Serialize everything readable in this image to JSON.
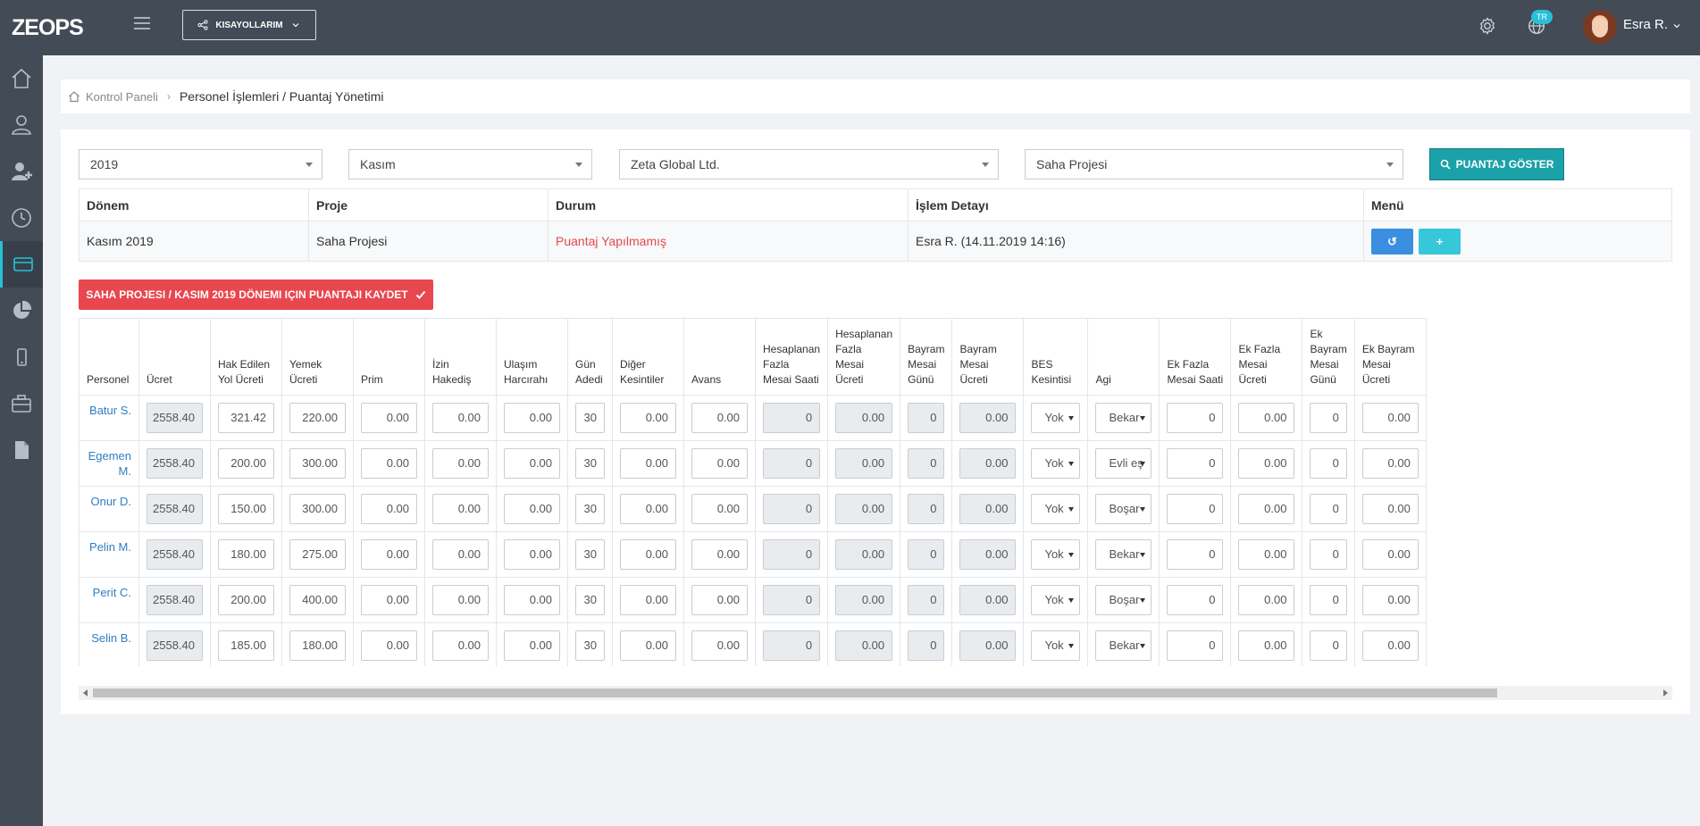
{
  "app": {
    "logo": "ZEOPS",
    "shortcuts_label": "KISAYOLLARIM",
    "lang_badge": "TR",
    "user_name": "Esra R."
  },
  "sidebar": {
    "items": [
      {
        "icon": "home-icon"
      },
      {
        "icon": "users-icon"
      },
      {
        "icon": "user-add-icon"
      },
      {
        "icon": "clock-icon"
      },
      {
        "icon": "credit-card-icon",
        "active": true
      },
      {
        "icon": "pie-chart-icon"
      },
      {
        "icon": "mobile-icon"
      },
      {
        "icon": "briefcase-icon"
      },
      {
        "icon": "document-icon"
      }
    ]
  },
  "breadcrumb": {
    "home": "Kontrol Paneli",
    "current": "Personel İşlemleri / Puantaj Yönetimi"
  },
  "filters": {
    "year": "2019",
    "month": "Kasım",
    "company": "Zeta Global Ltd.",
    "project": "Saha Projesi",
    "show_button": "PUANTAJ GÖSTER"
  },
  "summary": {
    "headers": [
      "Dönem",
      "Proje",
      "Durum",
      "İşlem Detayı",
      "Menü"
    ],
    "row": {
      "period": "Kasım 2019",
      "project": "Saha Projesi",
      "status": "Puantaj Yapılmamış",
      "detail": "Esra R. (14.11.2019 14:16)"
    }
  },
  "save_button": "SAHA PROJESI / KASIM 2019 DÖNEMI IÇIN PUANTAJI KAYDET",
  "grid": {
    "headers": [
      "Personel",
      "Ücret",
      "Hak Edilen Yol Ücreti",
      "Yemek Ücreti",
      "Prim",
      "İzin Hakediş",
      "Ulaşım Harcırahı",
      "Gün Adedi",
      "Diğer Kesintiler",
      "Avans",
      "Hesaplanan Fazla Mesai Saati",
      "Hesaplanan Fazla Mesai Ücreti",
      "Bayram Mesai Günü",
      "Bayram Mesai Ücreti",
      "BES Kesintisi",
      "Agi",
      "Ek Fazla Mesai Saati",
      "Ek Fazla Mesai Ücreti",
      "Ek Bayram Mesai Günü",
      "Ek Bayram Mesai Ücreti"
    ],
    "rows": [
      {
        "name": "Batur S.",
        "ucret": "2558.40",
        "yol": "321.42",
        "yemek": "220.00",
        "prim": "0.00",
        "izin": "0.00",
        "ulasim": "0.00",
        "gun": "30",
        "diger": "0.00",
        "avans": "0.00",
        "hfms": "0",
        "hfmu": "0.00",
        "bmg": "0",
        "bmu": "0.00",
        "bes": "Yok",
        "agi": "Bekar",
        "efms": "0",
        "efmu": "0.00",
        "ebmg": "0",
        "ebmu": "0.00"
      },
      {
        "name": "Egemen M.",
        "ucret": "2558.40",
        "yol": "200.00",
        "yemek": "300.00",
        "prim": "0.00",
        "izin": "0.00",
        "ulasim": "0.00",
        "gun": "30",
        "diger": "0.00",
        "avans": "0.00",
        "hfms": "0",
        "hfmu": "0.00",
        "bmg": "0",
        "bmu": "0.00",
        "bes": "Yok",
        "agi": "Evli eş",
        "efms": "0",
        "efmu": "0.00",
        "ebmg": "0",
        "ebmu": "0.00"
      },
      {
        "name": "Onur D.",
        "ucret": "2558.40",
        "yol": "150.00",
        "yemek": "300.00",
        "prim": "0.00",
        "izin": "0.00",
        "ulasim": "0.00",
        "gun": "30",
        "diger": "0.00",
        "avans": "0.00",
        "hfms": "0",
        "hfmu": "0.00",
        "bmg": "0",
        "bmu": "0.00",
        "bes": "Yok",
        "agi": "Boşar",
        "efms": "0",
        "efmu": "0.00",
        "ebmg": "0",
        "ebmu": "0.00"
      },
      {
        "name": "Pelin M.",
        "ucret": "2558.40",
        "yol": "180.00",
        "yemek": "275.00",
        "prim": "0.00",
        "izin": "0.00",
        "ulasim": "0.00",
        "gun": "30",
        "diger": "0.00",
        "avans": "0.00",
        "hfms": "0",
        "hfmu": "0.00",
        "bmg": "0",
        "bmu": "0.00",
        "bes": "Yok",
        "agi": "Bekar",
        "efms": "0",
        "efmu": "0.00",
        "ebmg": "0",
        "ebmu": "0.00"
      },
      {
        "name": "Perit C.",
        "ucret": "2558.40",
        "yol": "200.00",
        "yemek": "400.00",
        "prim": "0.00",
        "izin": "0.00",
        "ulasim": "0.00",
        "gun": "30",
        "diger": "0.00",
        "avans": "0.00",
        "hfms": "0",
        "hfmu": "0.00",
        "bmg": "0",
        "bmu": "0.00",
        "bes": "Yok",
        "agi": "Boşar",
        "efms": "0",
        "efmu": "0.00",
        "ebmg": "0",
        "ebmu": "0.00"
      },
      {
        "name": "Selin B.",
        "ucret": "2558.40",
        "yol": "185.00",
        "yemek": "180.00",
        "prim": "0.00",
        "izin": "0.00",
        "ulasim": "0.00",
        "gun": "30",
        "diger": "0.00",
        "avans": "0.00",
        "hfms": "0",
        "hfmu": "0.00",
        "bmg": "0",
        "bmu": "0.00",
        "bes": "Yok",
        "agi": "Bekar",
        "efms": "0",
        "efmu": "0.00",
        "ebmg": "0",
        "ebmu": "0.00"
      }
    ]
  },
  "colors": {
    "topbar": "#434b56",
    "accent": "#1aa2a8",
    "danger": "#e9474f",
    "link": "#2f7ec2"
  }
}
